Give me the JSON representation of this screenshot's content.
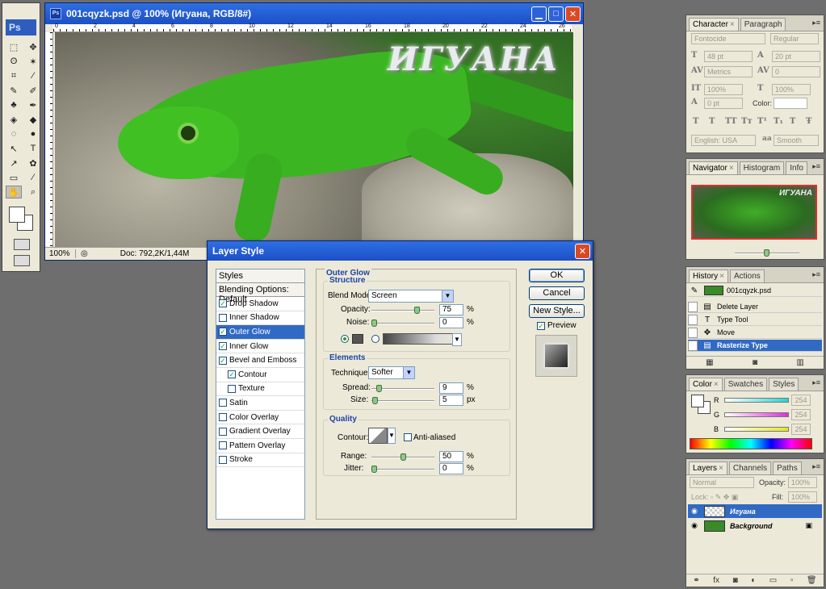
{
  "tools": {
    "logo": "Ps",
    "items": [
      "⬚",
      "✥",
      "ʘ",
      "✶",
      "⌗",
      "⁄",
      "✎",
      "✐",
      "♣",
      "✒",
      "◈",
      "◆",
      "◌",
      "●",
      "↖",
      "T",
      "↗",
      "✿",
      "▭",
      "⁄",
      "✋",
      "⌕"
    ]
  },
  "document": {
    "title": "001cqyzk.psd @ 100% (Игуана, RGB/8#)",
    "canvas_text": "ИГУАНА",
    "zoom": "100%",
    "doc_info": "Doc: 792,2K/1,44M",
    "ruler_labels": [
      "0",
      "2",
      "4",
      "6",
      "8",
      "10",
      "12",
      "14",
      "16",
      "18",
      "20",
      "22",
      "24",
      "26"
    ]
  },
  "layer_style": {
    "title": "Layer Style",
    "styles_header": "Styles",
    "blending_options": "Blending Options: Default",
    "items": [
      {
        "label": "Drop Shadow",
        "checked": true,
        "indent": false,
        "selected": false
      },
      {
        "label": "Inner Shadow",
        "checked": false,
        "indent": false,
        "selected": false
      },
      {
        "label": "Outer Glow",
        "checked": true,
        "indent": false,
        "selected": true
      },
      {
        "label": "Inner Glow",
        "checked": true,
        "indent": false,
        "selected": false
      },
      {
        "label": "Bevel and Emboss",
        "checked": true,
        "indent": false,
        "selected": false
      },
      {
        "label": "Contour",
        "checked": true,
        "indent": true,
        "selected": false
      },
      {
        "label": "Texture",
        "checked": false,
        "indent": true,
        "selected": false
      },
      {
        "label": "Satin",
        "checked": false,
        "indent": false,
        "selected": false
      },
      {
        "label": "Color Overlay",
        "checked": false,
        "indent": false,
        "selected": false
      },
      {
        "label": "Gradient Overlay",
        "checked": false,
        "indent": false,
        "selected": false
      },
      {
        "label": "Pattern Overlay",
        "checked": false,
        "indent": false,
        "selected": false
      },
      {
        "label": "Stroke",
        "checked": false,
        "indent": false,
        "selected": false
      }
    ],
    "pane_title": "Outer Glow",
    "structure": {
      "title": "Structure",
      "blend_mode_label": "Blend Mode:",
      "blend_mode": "Screen",
      "opacity_label": "Opacity:",
      "opacity": "75",
      "noise_label": "Noise:",
      "noise": "0",
      "unit_pct": "%"
    },
    "elements": {
      "title": "Elements",
      "technique_label": "Technique:",
      "technique": "Softer",
      "spread_label": "Spread:",
      "spread": "9",
      "size_label": "Size:",
      "size": "5",
      "unit_px": "px"
    },
    "quality": {
      "title": "Quality",
      "contour_label": "Contour:",
      "anti_aliased": "Anti-aliased",
      "range_label": "Range:",
      "range": "50",
      "jitter_label": "Jitter:",
      "jitter": "0"
    },
    "buttons": {
      "ok": "OK",
      "cancel": "Cancel",
      "new_style": "New Style...",
      "preview": "Preview"
    }
  },
  "character_panel": {
    "tabs": [
      "Character",
      "Paragraph"
    ],
    "font_family": "Fontocide",
    "font_style": "Regular",
    "font_size": "48 pt",
    "leading": "20 pt",
    "kerning": "Metrics",
    "tracking": "0",
    "vscale": "100%",
    "hscale": "100%",
    "baseline": "0 pt",
    "color_label": "Color:",
    "type_buttons": [
      "T",
      "T",
      "TT",
      "Tт",
      "T¹",
      "T₁",
      "T",
      "Ŧ"
    ],
    "language": "English: USA",
    "aa_label": "aa",
    "aa": "Smooth"
  },
  "navigator_panel": {
    "tabs": [
      "Navigator",
      "Histogram",
      "Info"
    ],
    "thumb_text": "ИГУАНА"
  },
  "history_panel": {
    "tabs": [
      "History",
      "Actions"
    ],
    "snapshot": "001cqyzk.psd",
    "items": [
      {
        "label": "Delete Layer",
        "icon": "▤",
        "selected": false
      },
      {
        "label": "Type Tool",
        "icon": "T",
        "selected": false
      },
      {
        "label": "Move",
        "icon": "✥",
        "selected": false
      },
      {
        "label": "Rasterize Type",
        "icon": "▤",
        "selected": true
      }
    ]
  },
  "color_panel": {
    "tabs": [
      "Color",
      "Swatches",
      "Styles"
    ],
    "channels": [
      {
        "label": "R",
        "value": "254",
        "color": "#27d3d3"
      },
      {
        "label": "G",
        "value": "254",
        "color": "#e02ce0"
      },
      {
        "label": "B",
        "value": "254",
        "color": "#e6e62a"
      }
    ]
  },
  "layers_panel": {
    "tabs": [
      "Layers",
      "Channels",
      "Paths"
    ],
    "blend": "Normal",
    "opacity_label": "Opacity:",
    "opacity": "100%",
    "lock_label": "Lock:",
    "fill_label": "Fill:",
    "fill": "100%",
    "layers": [
      {
        "name": "Игуана",
        "selected": true
      },
      {
        "name": "Background",
        "selected": false
      }
    ],
    "footer_icons": [
      "⚭",
      "fx",
      "◙",
      "◐",
      "▭",
      "▫",
      "🗑"
    ]
  }
}
